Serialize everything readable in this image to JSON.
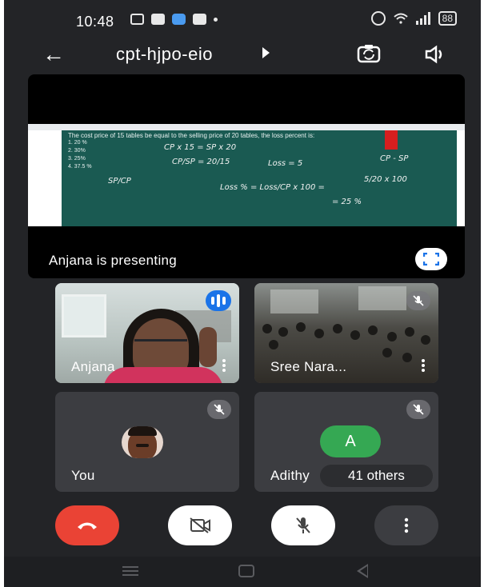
{
  "status_bar": {
    "time": "10:48",
    "battery": "88",
    "icons": [
      "screen-record-icon",
      "message-icon",
      "app-icon",
      "facebook-icon",
      "dot-icon",
      "alarm-icon",
      "wifi-icon",
      "signal-icon",
      "battery-icon"
    ]
  },
  "top_bar": {
    "meeting_code": "cpt-hjpo-eio",
    "icons": [
      "back-arrow-icon",
      "switch-camera-icon",
      "speaker-icon"
    ]
  },
  "presentation": {
    "presenter_label": "Anjana is presenting",
    "slide": {
      "question": "The cost price of 15 tables be equal to the selling price of 20 tables, the loss percent is:",
      "options": [
        "1.   20 %",
        "2.   30%",
        "3.   25%",
        "4.   37.5 %"
      ],
      "handwriting": [
        "CP x 15  =  SP x 20",
        "CP/SP = 20/15",
        "Loss = 5",
        "CP - SP",
        "SP/CP",
        "Loss % = Loss/CP x 100 =",
        "5/20 x 100",
        "= 25 %"
      ]
    }
  },
  "participants": [
    {
      "name": "Anjana",
      "state": "speaking"
    },
    {
      "name": "Sree Nara...",
      "state": "muted"
    },
    {
      "name": "You",
      "state": "muted"
    },
    {
      "name": "Adithy",
      "avatar_letter": "A",
      "state": "muted"
    }
  ],
  "others_label": "41 others",
  "controls": [
    "end-call-icon",
    "camera-off-icon",
    "mic-off-icon",
    "more-vert-icon"
  ],
  "colors": {
    "background": "#232427",
    "end_call": "#ea4335",
    "speaking_badge": "#1a73e8",
    "avatar_green": "#35a853",
    "board": "#1a5a52"
  }
}
